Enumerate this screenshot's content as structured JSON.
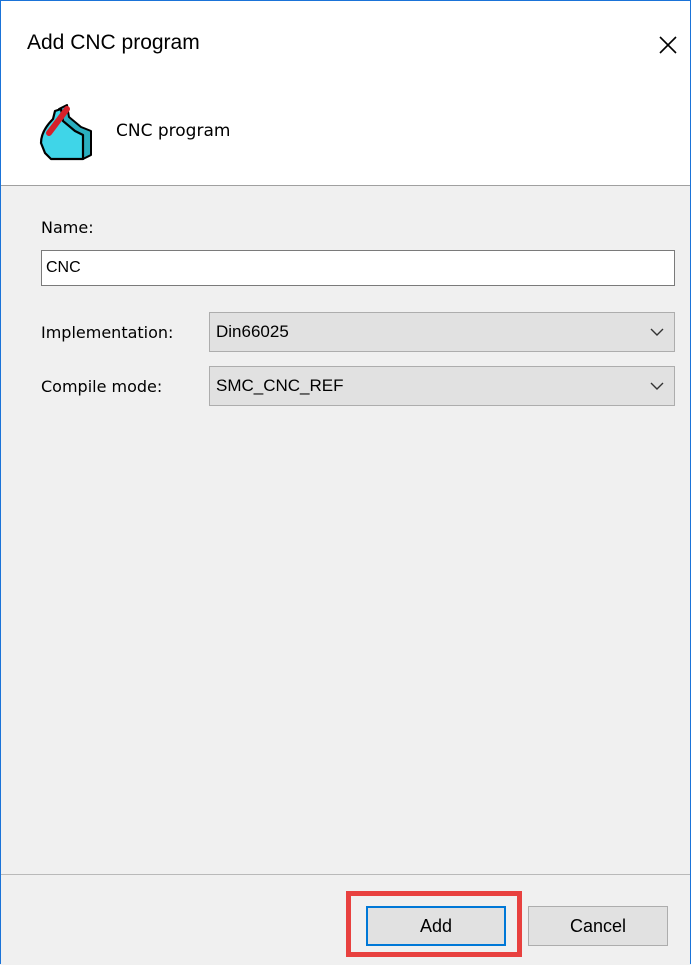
{
  "dialog": {
    "title": "Add CNC program",
    "close_icon": "close-icon"
  },
  "header": {
    "icon": "cnc-program-icon",
    "label": "CNC program"
  },
  "form": {
    "name_label": "Name:",
    "name_value": "CNC",
    "implementation_label": "Implementation:",
    "implementation_value": "Din66025",
    "compile_mode_label": "Compile mode:",
    "compile_mode_value": "SMC_CNC_REF"
  },
  "buttons": {
    "add_label": "Add",
    "cancel_label": "Cancel"
  },
  "colors": {
    "window_border": "#1a73d8",
    "highlight": "#e8413f",
    "default_button_border": "#0078d7",
    "icon_cyan": "#3fd5e8",
    "icon_red": "#d6202a"
  }
}
